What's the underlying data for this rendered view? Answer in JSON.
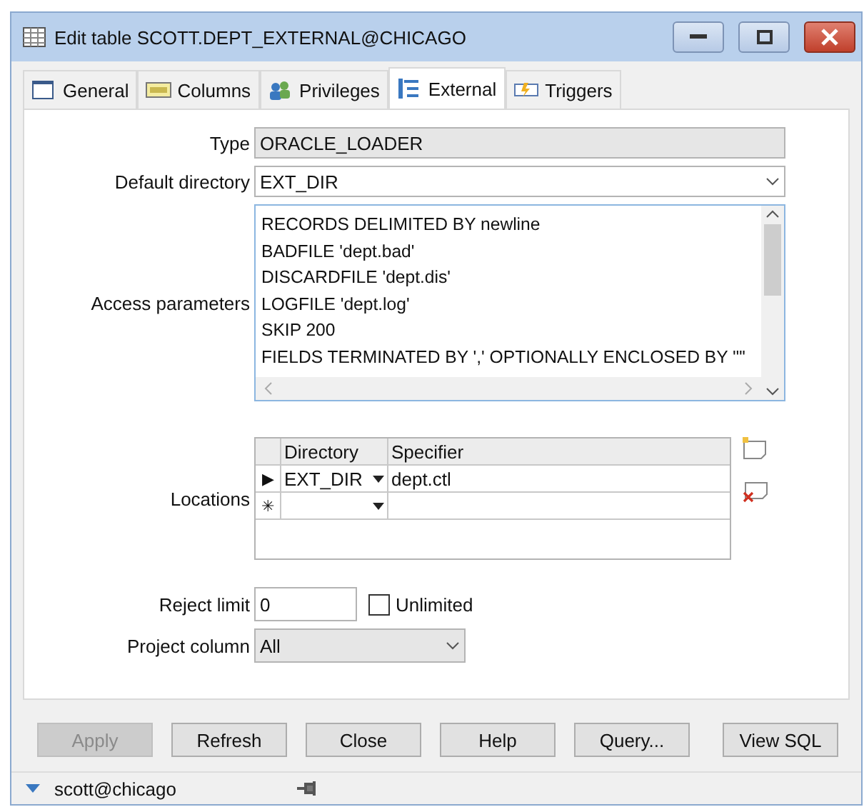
{
  "window": {
    "title": "Edit table SCOTT.DEPT_EXTERNAL@CHICAGO"
  },
  "tabs": [
    {
      "label": "General",
      "selected": false
    },
    {
      "label": "Columns",
      "selected": false
    },
    {
      "label": "Privileges",
      "selected": false
    },
    {
      "label": "External",
      "selected": true
    },
    {
      "label": "Triggers",
      "selected": false
    }
  ],
  "form": {
    "type": {
      "label": "Type",
      "value": "ORACLE_LOADER"
    },
    "default_directory": {
      "label": "Default directory",
      "value": "EXT_DIR"
    },
    "access_parameters": {
      "label": "Access parameters",
      "lines": [
        "RECORDS DELIMITED BY newline",
        "BADFILE 'dept.bad'",
        "DISCARDFILE 'dept.dis'",
        "LOGFILE 'dept.log'",
        "SKIP 200",
        "FIELDS TERMINATED BY ',' OPTIONALLY ENCLOSED BY '\"'"
      ]
    },
    "locations": {
      "label": "Locations",
      "columns": [
        "Directory",
        "Specifier"
      ],
      "rows": [
        {
          "marker": "▶",
          "directory": "EXT_DIR",
          "specifier": "dept.ctl"
        },
        {
          "marker": "✳"
        }
      ]
    },
    "reject_limit": {
      "label": "Reject limit",
      "value": "0",
      "unlimited_label": "Unlimited",
      "checked": false
    },
    "project_column": {
      "label": "Project column",
      "value": "All"
    }
  },
  "buttons": [
    {
      "label": "Apply",
      "disabled": true
    },
    {
      "label": "Refresh",
      "disabled": false
    },
    {
      "label": "Close",
      "disabled": false
    },
    {
      "label": "Help",
      "disabled": false
    },
    {
      "label": "Query...",
      "disabled": false
    },
    {
      "label": "View SQL",
      "disabled": false
    }
  ],
  "status_bar": {
    "connection": "scott@chicago"
  }
}
